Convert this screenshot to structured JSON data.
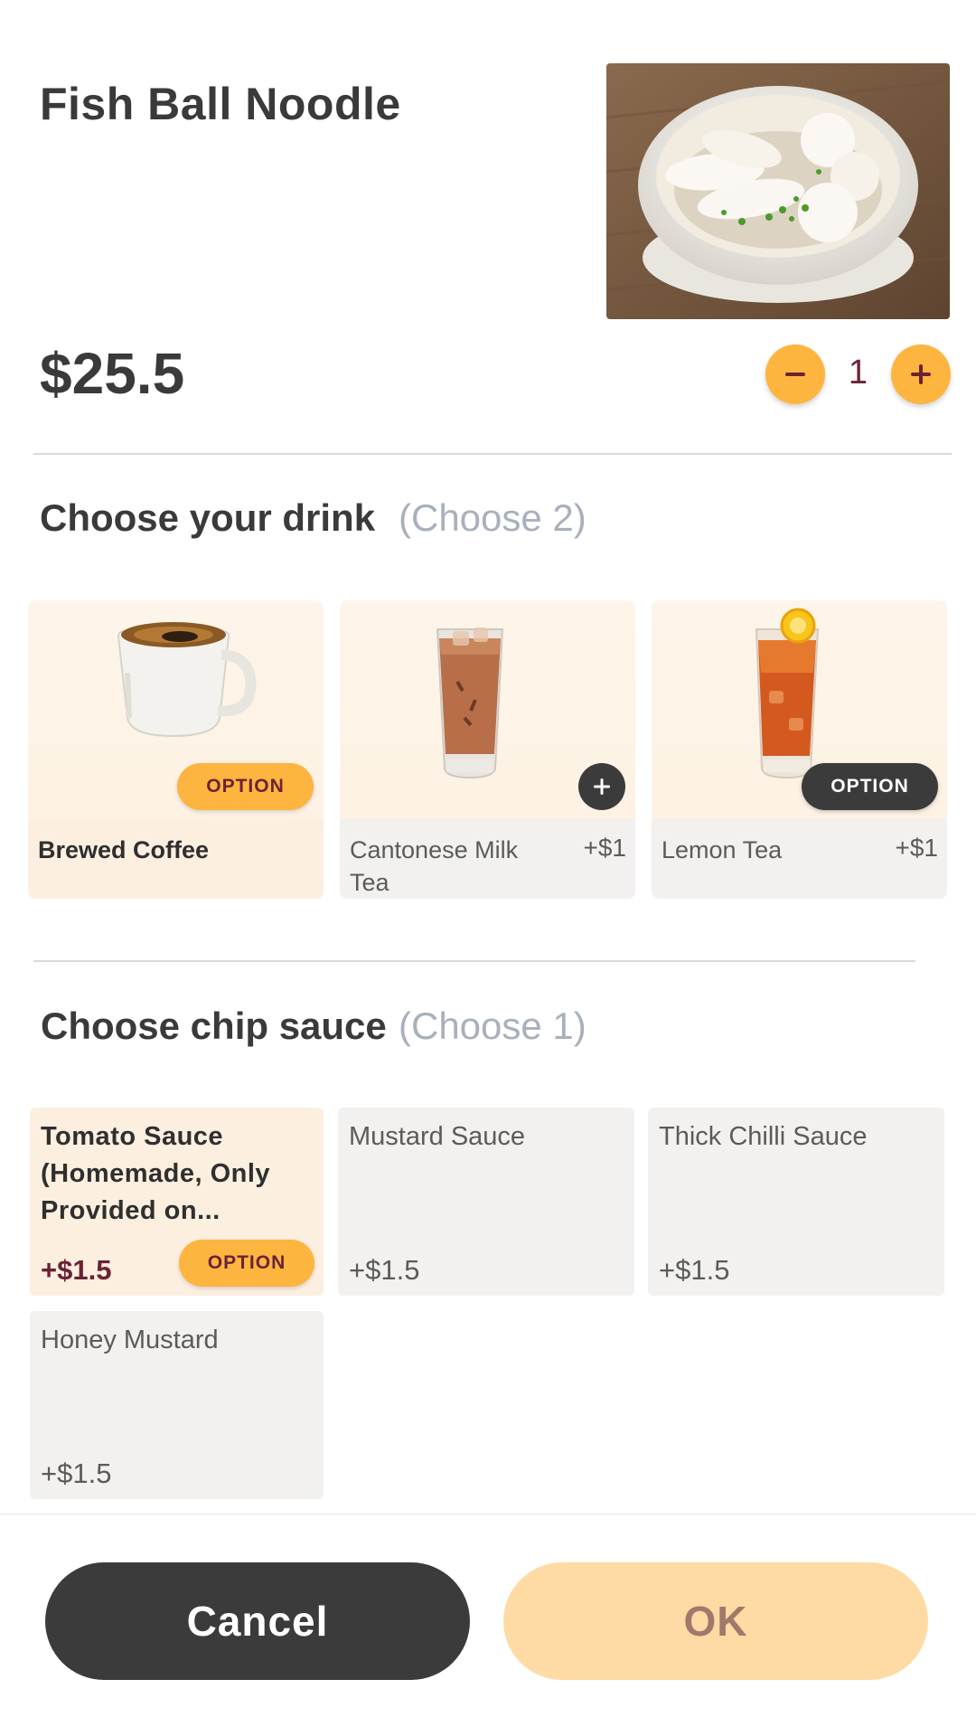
{
  "item": {
    "title": "Fish Ball Noodle",
    "price": "$25.5",
    "quantity": "1"
  },
  "drinks": {
    "title": "Choose your drink",
    "hint": "(Choose 2)",
    "items": [
      {
        "name": "Brewed Coffee",
        "addon": "",
        "badge": "OPTION",
        "selected": true
      },
      {
        "name": "Cantonese Milk Tea",
        "addon": "+$1",
        "badge": "",
        "selected": false
      },
      {
        "name": "Lemon Tea",
        "addon": "+$1",
        "badge": "OPTION",
        "selected": false
      }
    ]
  },
  "sauce": {
    "title": "Choose chip sauce",
    "hint": "(Choose 1)",
    "items": [
      {
        "name": "Tomato Sauce (Homemade, Only Provided on...",
        "price": "+$1.5",
        "badge": "OPTION",
        "selected": true
      },
      {
        "name": "Mustard Sauce",
        "price": "+$1.5",
        "selected": false
      },
      {
        "name": "Thick Chilli Sauce",
        "price": "+$1.5",
        "selected": false
      },
      {
        "name": "Honey Mustard",
        "price": "+$1.5",
        "selected": false
      }
    ]
  },
  "footer": {
    "cancel_label": "Cancel",
    "ok_label": "OK"
  },
  "colors": {
    "accent": "#fdb53f",
    "dark": "#3b3b3b",
    "maroon": "#6b2235",
    "ok_disabled_bg": "#fedba4"
  },
  "icons": {
    "minus": "minus-icon",
    "plus": "plus-icon"
  }
}
